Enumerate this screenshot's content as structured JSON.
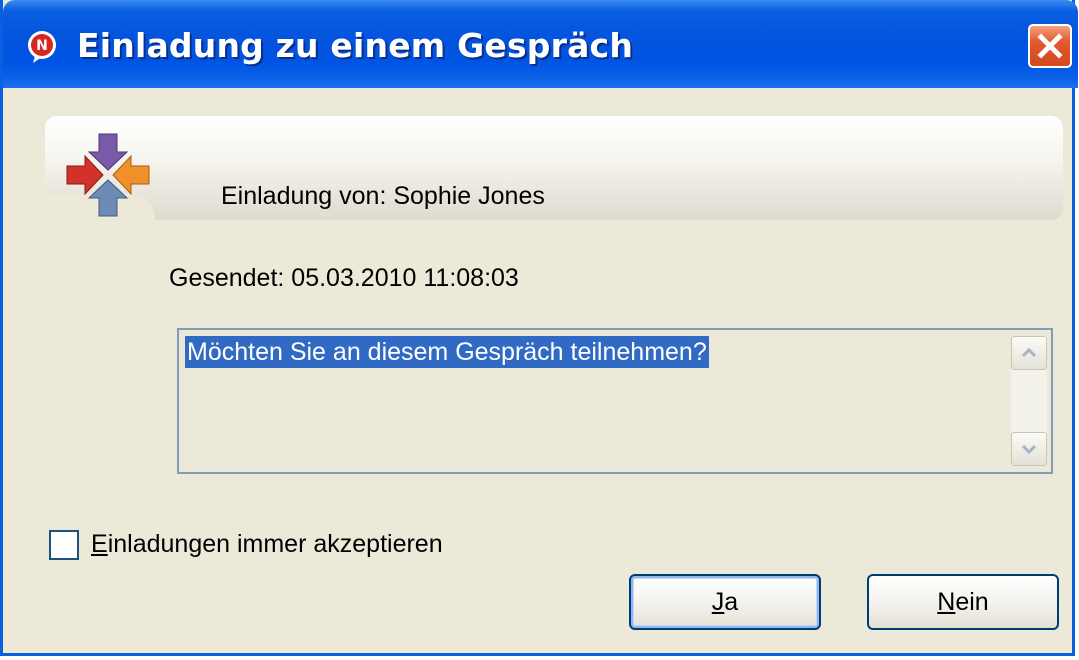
{
  "window": {
    "title": "Einladung zu einem Gespräch"
  },
  "banner": {
    "invite_from": "Einladung von: Sophie Jones"
  },
  "sent": "Gesendet: 05.03.2010 11:08:03",
  "message": "Möchten Sie an diesem Gespräch teilnehmen?",
  "checkbox": {
    "label_mnemonic": "E",
    "label_rest": "inladungen immer akzeptieren",
    "checked": false
  },
  "buttons": {
    "yes_mnemonic": "J",
    "yes_rest": "a",
    "no_mnemonic": "N",
    "no_rest": "ein"
  },
  "icons": {
    "title": "app-icon",
    "banner": "conversation-arrows-icon",
    "close": "close-icon"
  },
  "colors": {
    "titlebar": "#0054e3",
    "close_button": "#e2582f",
    "selection": "#316ac5"
  }
}
